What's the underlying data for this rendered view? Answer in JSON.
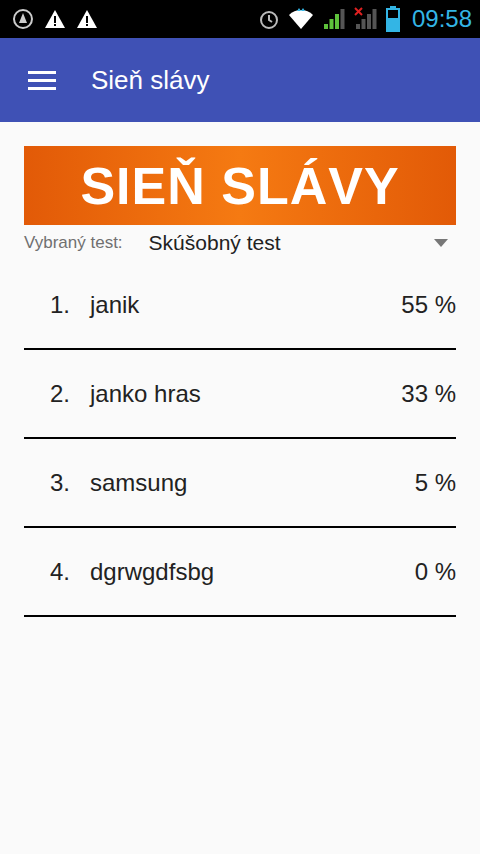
{
  "status_bar": {
    "time": "09:58",
    "battery": {
      "level": 0.6
    },
    "signals": [
      {
        "level": 0.75,
        "disconnected": false
      },
      {
        "level": 0,
        "disconnected": true
      }
    ]
  },
  "app_bar": {
    "title": "Sieň slávy"
  },
  "banner": {
    "text": "SIEŇ SLÁVY"
  },
  "test_select": {
    "label": "Vybraný test:",
    "value": "Skúšobný test"
  },
  "leaderboard": [
    {
      "rank": "1.",
      "name": "janik",
      "score": "55 %"
    },
    {
      "rank": "2.",
      "name": "janko hras",
      "score": "33 %"
    },
    {
      "rank": "3.",
      "name": "samsung",
      "score": "5 %"
    },
    {
      "rank": "4.",
      "name": "dgrwgdfsbg",
      "score": "0 %"
    }
  ]
}
